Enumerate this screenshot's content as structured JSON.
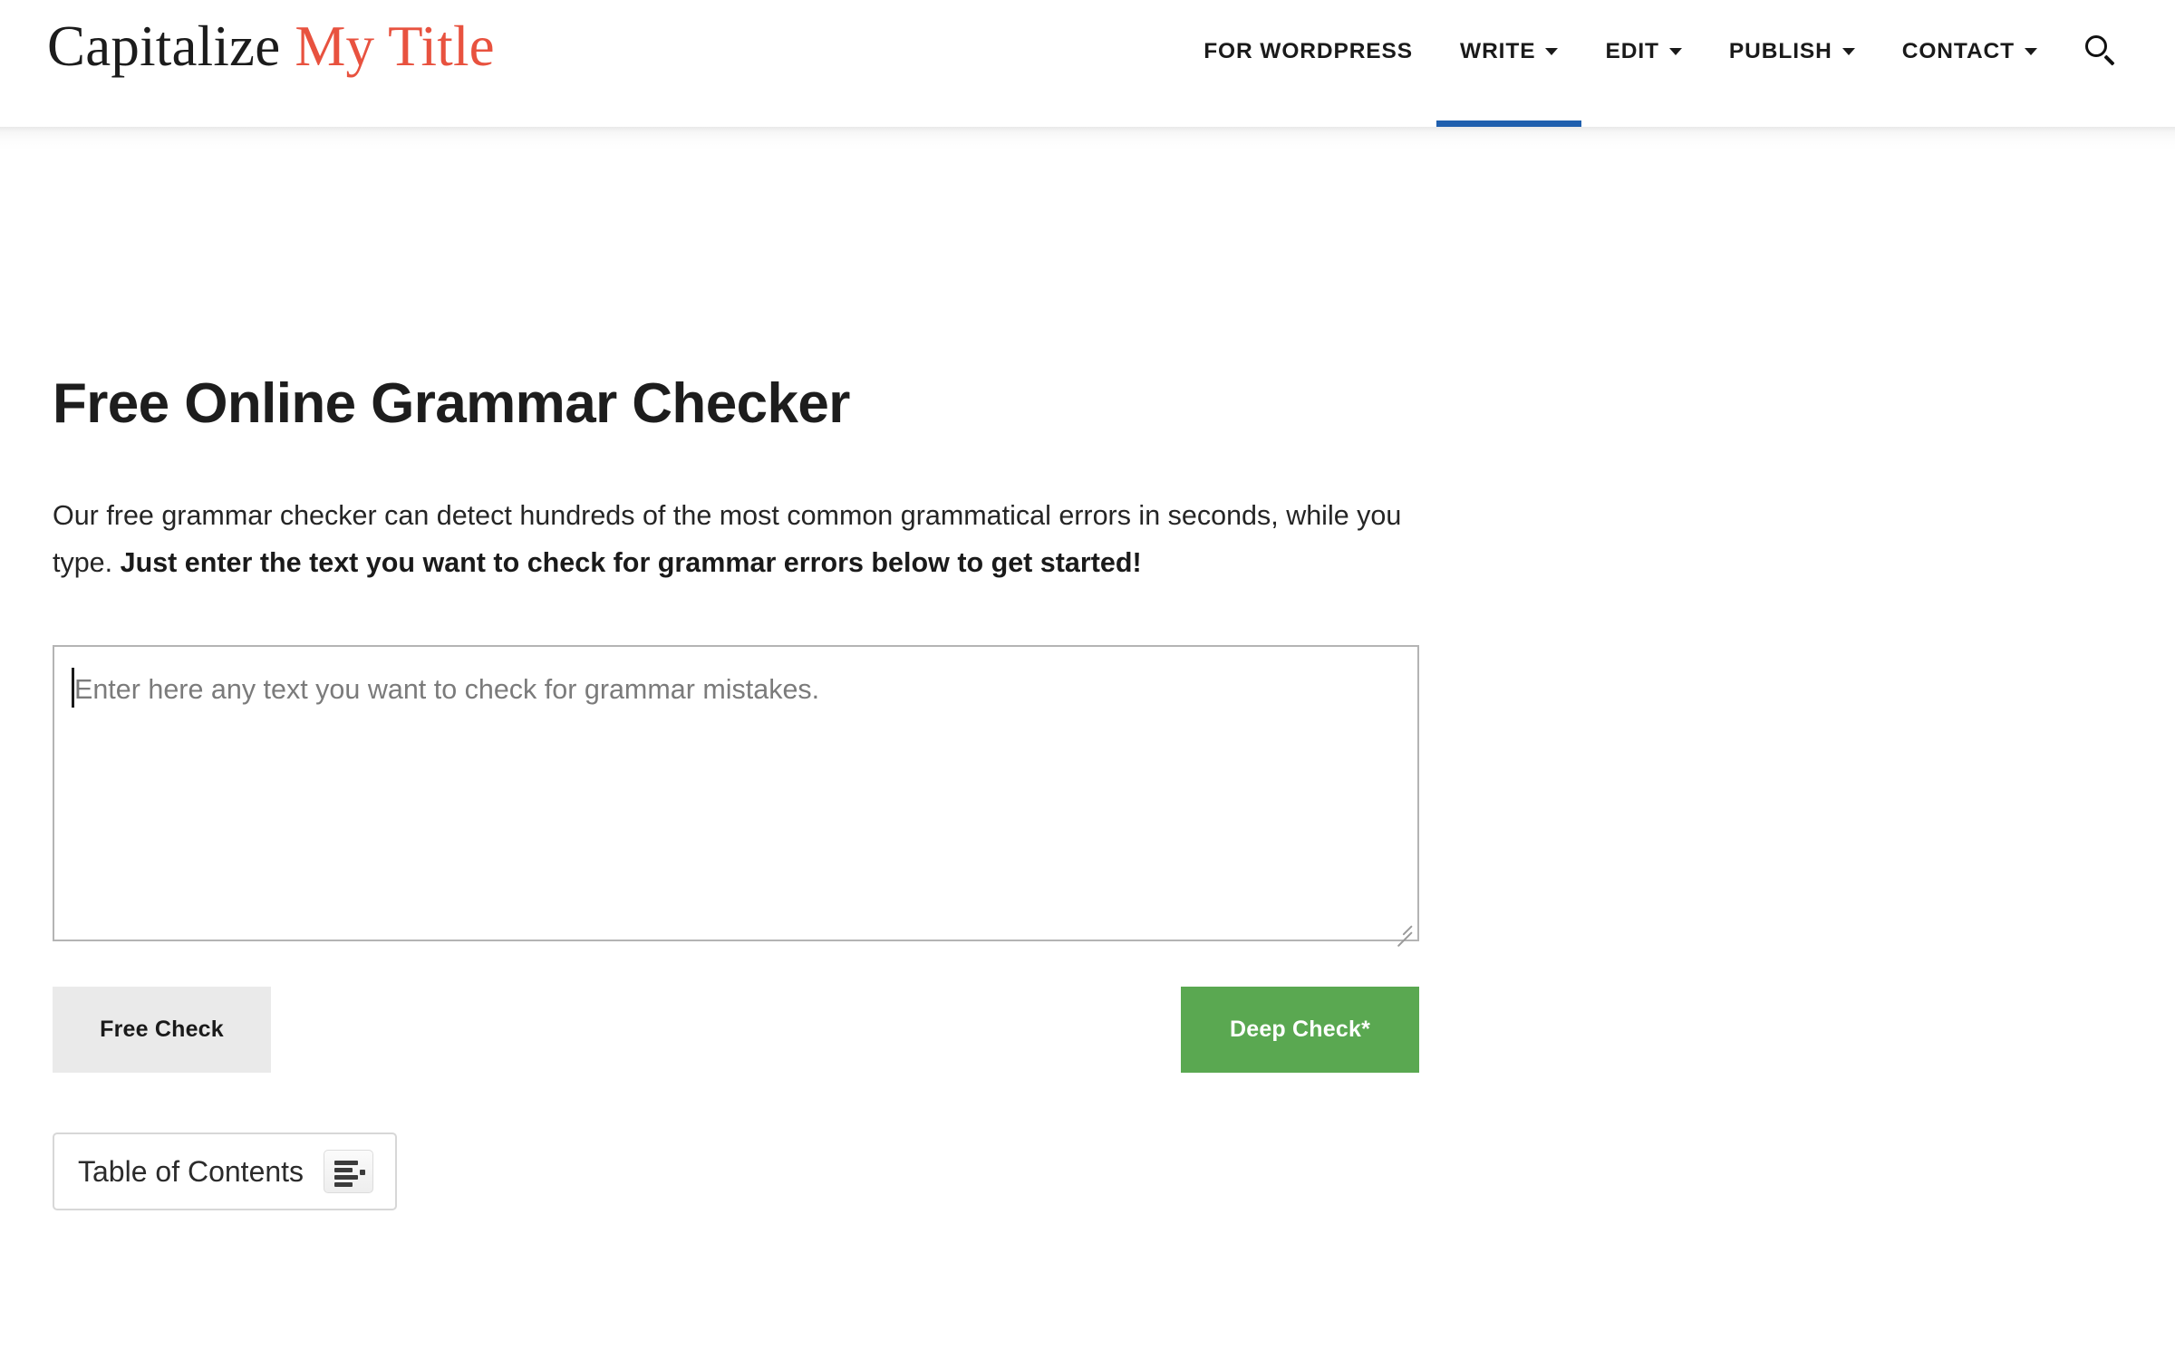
{
  "header": {
    "logo": {
      "primary": "Capitalize",
      "accent": "My Title",
      "accent_color": "#e8523f"
    },
    "nav_items": [
      {
        "label": "FOR WORDPRESS",
        "has_dropdown": false,
        "active": false
      },
      {
        "label": "WRITE",
        "has_dropdown": true,
        "active": true
      },
      {
        "label": "EDIT",
        "has_dropdown": true,
        "active": false
      },
      {
        "label": "PUBLISH",
        "has_dropdown": true,
        "active": false
      },
      {
        "label": "CONTACT",
        "has_dropdown": true,
        "active": false
      }
    ],
    "search_icon": "search-icon",
    "active_underline_color": "#1f5fae"
  },
  "main": {
    "title": "Free Online Grammar Checker",
    "intro": {
      "normal_part": "Our free grammar checker can detect hundreds of the most common grammatical errors in seconds, while you type. ",
      "bold_part": "Just enter the text you want to check for grammar errors below to get started!"
    },
    "checker": {
      "placeholder": "Enter here any text you want to check for grammar mistakes.",
      "value": "",
      "focused": true,
      "resizable": true
    },
    "buttons": {
      "free_check": {
        "label": "Free Check",
        "bg_color": "#eaeaea",
        "text_color": "#1a1a1a"
      },
      "deep_check": {
        "label": "Deep Check*",
        "bg_color": "#5aa851",
        "text_color": "#ffffff"
      }
    },
    "table_of_contents": {
      "label": "Table of Contents",
      "toggle_icon": "list-bullets-icon",
      "expanded": false
    }
  }
}
